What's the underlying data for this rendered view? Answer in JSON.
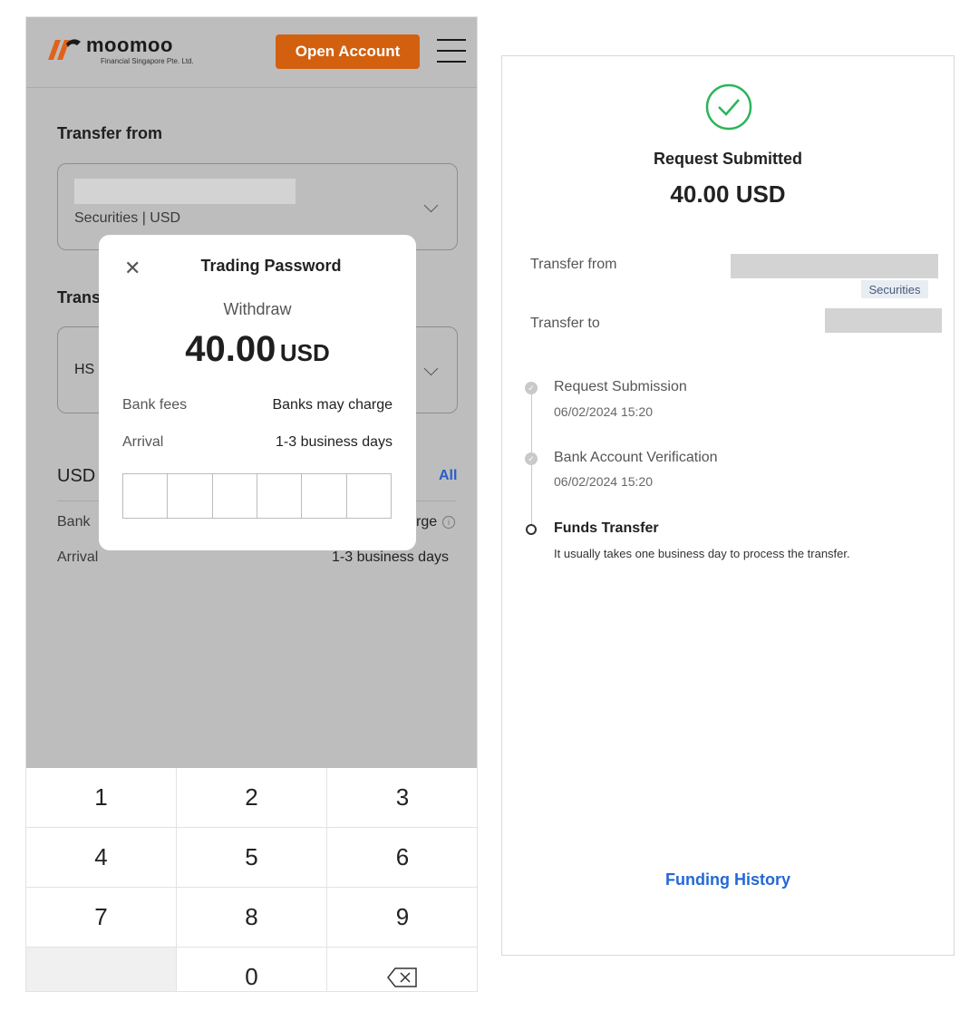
{
  "left": {
    "brand": {
      "name": "moomoo",
      "subtitle": "Financial Singapore Pte. Ltd."
    },
    "open_account_label": "Open Account",
    "transfer_from": {
      "label": "Transfer from",
      "account_sub": "Securities | USD"
    },
    "transfer_to": {
      "label_partial": "Trans",
      "account_partial": "HS"
    },
    "usd_section": {
      "label_partial": "USD",
      "all_link": "All"
    },
    "fees_row": {
      "label_partial": "Bank",
      "value_partial": "rge"
    },
    "arrival_row": {
      "label": "Arrival",
      "value": "1-3 business days"
    },
    "modal": {
      "close_icon": "close-icon",
      "title": "Trading Password",
      "subtitle": "Withdraw",
      "amount": "40.00",
      "currency": "USD",
      "bank_fees_label": "Bank fees",
      "bank_fees_value": "Banks may charge",
      "arrival_label": "Arrival",
      "arrival_value": "1-3 business days"
    },
    "keypad": {
      "keys": [
        "1",
        "2",
        "3",
        "4",
        "5",
        "6",
        "7",
        "8",
        "9",
        "",
        "0",
        "⌫"
      ]
    }
  },
  "right": {
    "status_title": "Request Submitted",
    "amount": "40.00 USD",
    "transfer_from_label": "Transfer from",
    "transfer_from_badge": "Securities",
    "transfer_to_label": "Transfer to",
    "timeline": [
      {
        "title": "Request Submission",
        "date": "06/02/2024 15:20",
        "done": true
      },
      {
        "title": "Bank Account Verification",
        "date": "06/02/2024 15:20",
        "done": true
      },
      {
        "title": "Funds Transfer",
        "note": "It usually takes one business day to process the transfer.",
        "done": false
      }
    ],
    "funding_history_label": "Funding History"
  },
  "colors": {
    "brand_orange": "#d2600f",
    "success_green": "#2bb55a",
    "link_blue": "#2468d6"
  }
}
